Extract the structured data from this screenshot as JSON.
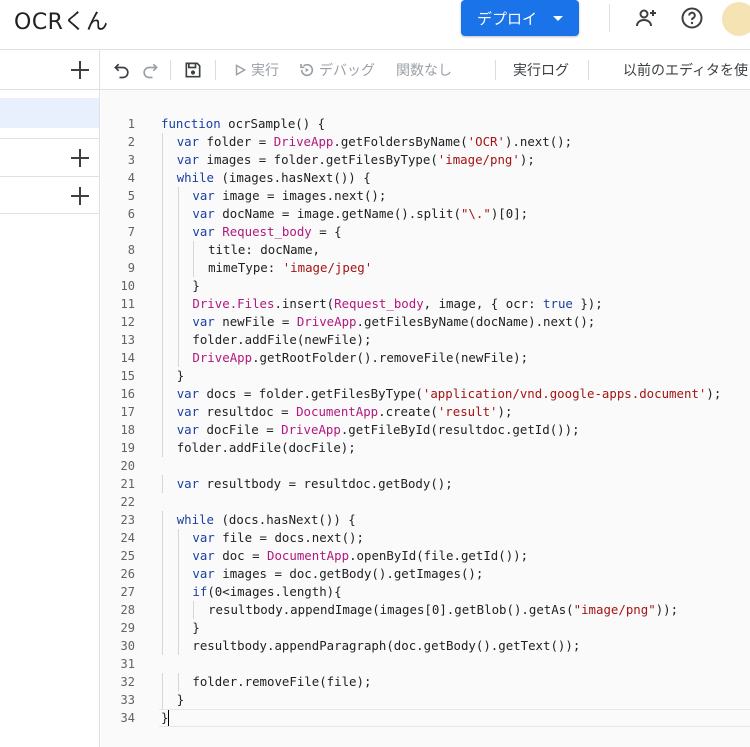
{
  "header": {
    "title": "OCRくん",
    "deploy_label": "デプロイ"
  },
  "toolbar": {
    "run_label": "実行",
    "debug_label": "デバッグ",
    "function_label": "関数なし",
    "log_label": "実行ログ",
    "legacy_label": "以前のエディタを使"
  },
  "editor": {
    "lines": [
      {
        "num": "1",
        "indent": 0,
        "code": "function ocrSample() {"
      },
      {
        "num": "2",
        "indent": 1,
        "code": "var folder = DriveApp.getFoldersByName('OCR').next();"
      },
      {
        "num": "3",
        "indent": 1,
        "code": "var images = folder.getFilesByType('image/png');"
      },
      {
        "num": "4",
        "indent": 1,
        "code": "while (images.hasNext()) {"
      },
      {
        "num": "5",
        "indent": 2,
        "code": "var image = images.next();"
      },
      {
        "num": "6",
        "indent": 2,
        "code": "var docName = image.getName().split(\"\\.\")[0];"
      },
      {
        "num": "7",
        "indent": 2,
        "code": "var Request_body = {"
      },
      {
        "num": "8",
        "indent": 3,
        "code": "title: docName,"
      },
      {
        "num": "9",
        "indent": 3,
        "code": "mimeType: 'image/jpeg'"
      },
      {
        "num": "10",
        "indent": 2,
        "code": "}"
      },
      {
        "num": "11",
        "indent": 2,
        "code": "Drive.Files.insert(Request_body, image, { ocr: true });"
      },
      {
        "num": "12",
        "indent": 2,
        "code": "var newFile = DriveApp.getFilesByName(docName).next();"
      },
      {
        "num": "13",
        "indent": 2,
        "code": "folder.addFile(newFile);"
      },
      {
        "num": "14",
        "indent": 2,
        "code": "DriveApp.getRootFolder().removeFile(newFile);"
      },
      {
        "num": "15",
        "indent": 1,
        "code": "}"
      },
      {
        "num": "16",
        "indent": 1,
        "code": "var docs = folder.getFilesByType('application/vnd.google-apps.document');"
      },
      {
        "num": "17",
        "indent": 1,
        "code": "var resultdoc = DocumentApp.create('result');"
      },
      {
        "num": "18",
        "indent": 1,
        "code": "var docFile = DriveApp.getFileById(resultdoc.getId());"
      },
      {
        "num": "19",
        "indent": 1,
        "code": "folder.addFile(docFile);"
      },
      {
        "num": "20",
        "indent": 0,
        "code": ""
      },
      {
        "num": "21",
        "indent": 1,
        "code": "var resultbody = resultdoc.getBody();"
      },
      {
        "num": "22",
        "indent": 0,
        "code": ""
      },
      {
        "num": "23",
        "indent": 1,
        "code": "while (docs.hasNext()) {"
      },
      {
        "num": "24",
        "indent": 2,
        "code": "var file = docs.next();"
      },
      {
        "num": "25",
        "indent": 2,
        "code": "var doc = DocumentApp.openById(file.getId());"
      },
      {
        "num": "26",
        "indent": 2,
        "code": "var images = doc.getBody().getImages();"
      },
      {
        "num": "27",
        "indent": 2,
        "code": "if(0<images.length){"
      },
      {
        "num": "28",
        "indent": 3,
        "code": "resultbody.appendImage(images[0].getBlob().getAs(\"image/png\"));"
      },
      {
        "num": "29",
        "indent": 2,
        "code": "}"
      },
      {
        "num": "30",
        "indent": 2,
        "code": "resultbody.appendParagraph(doc.getBody().getText());"
      },
      {
        "num": "31",
        "indent": 0,
        "code": ""
      },
      {
        "num": "32",
        "indent": 2,
        "code": "folder.removeFile(file);"
      },
      {
        "num": "33",
        "indent": 1,
        "code": "}"
      },
      {
        "num": "34",
        "indent": 0,
        "code": "}"
      }
    ]
  },
  "colors": {
    "accent": "#1a73e8",
    "keyword": "#1a3fa0",
    "string": "#a31515",
    "class": "#b0197e",
    "selected_bg": "#e8f0fe"
  }
}
